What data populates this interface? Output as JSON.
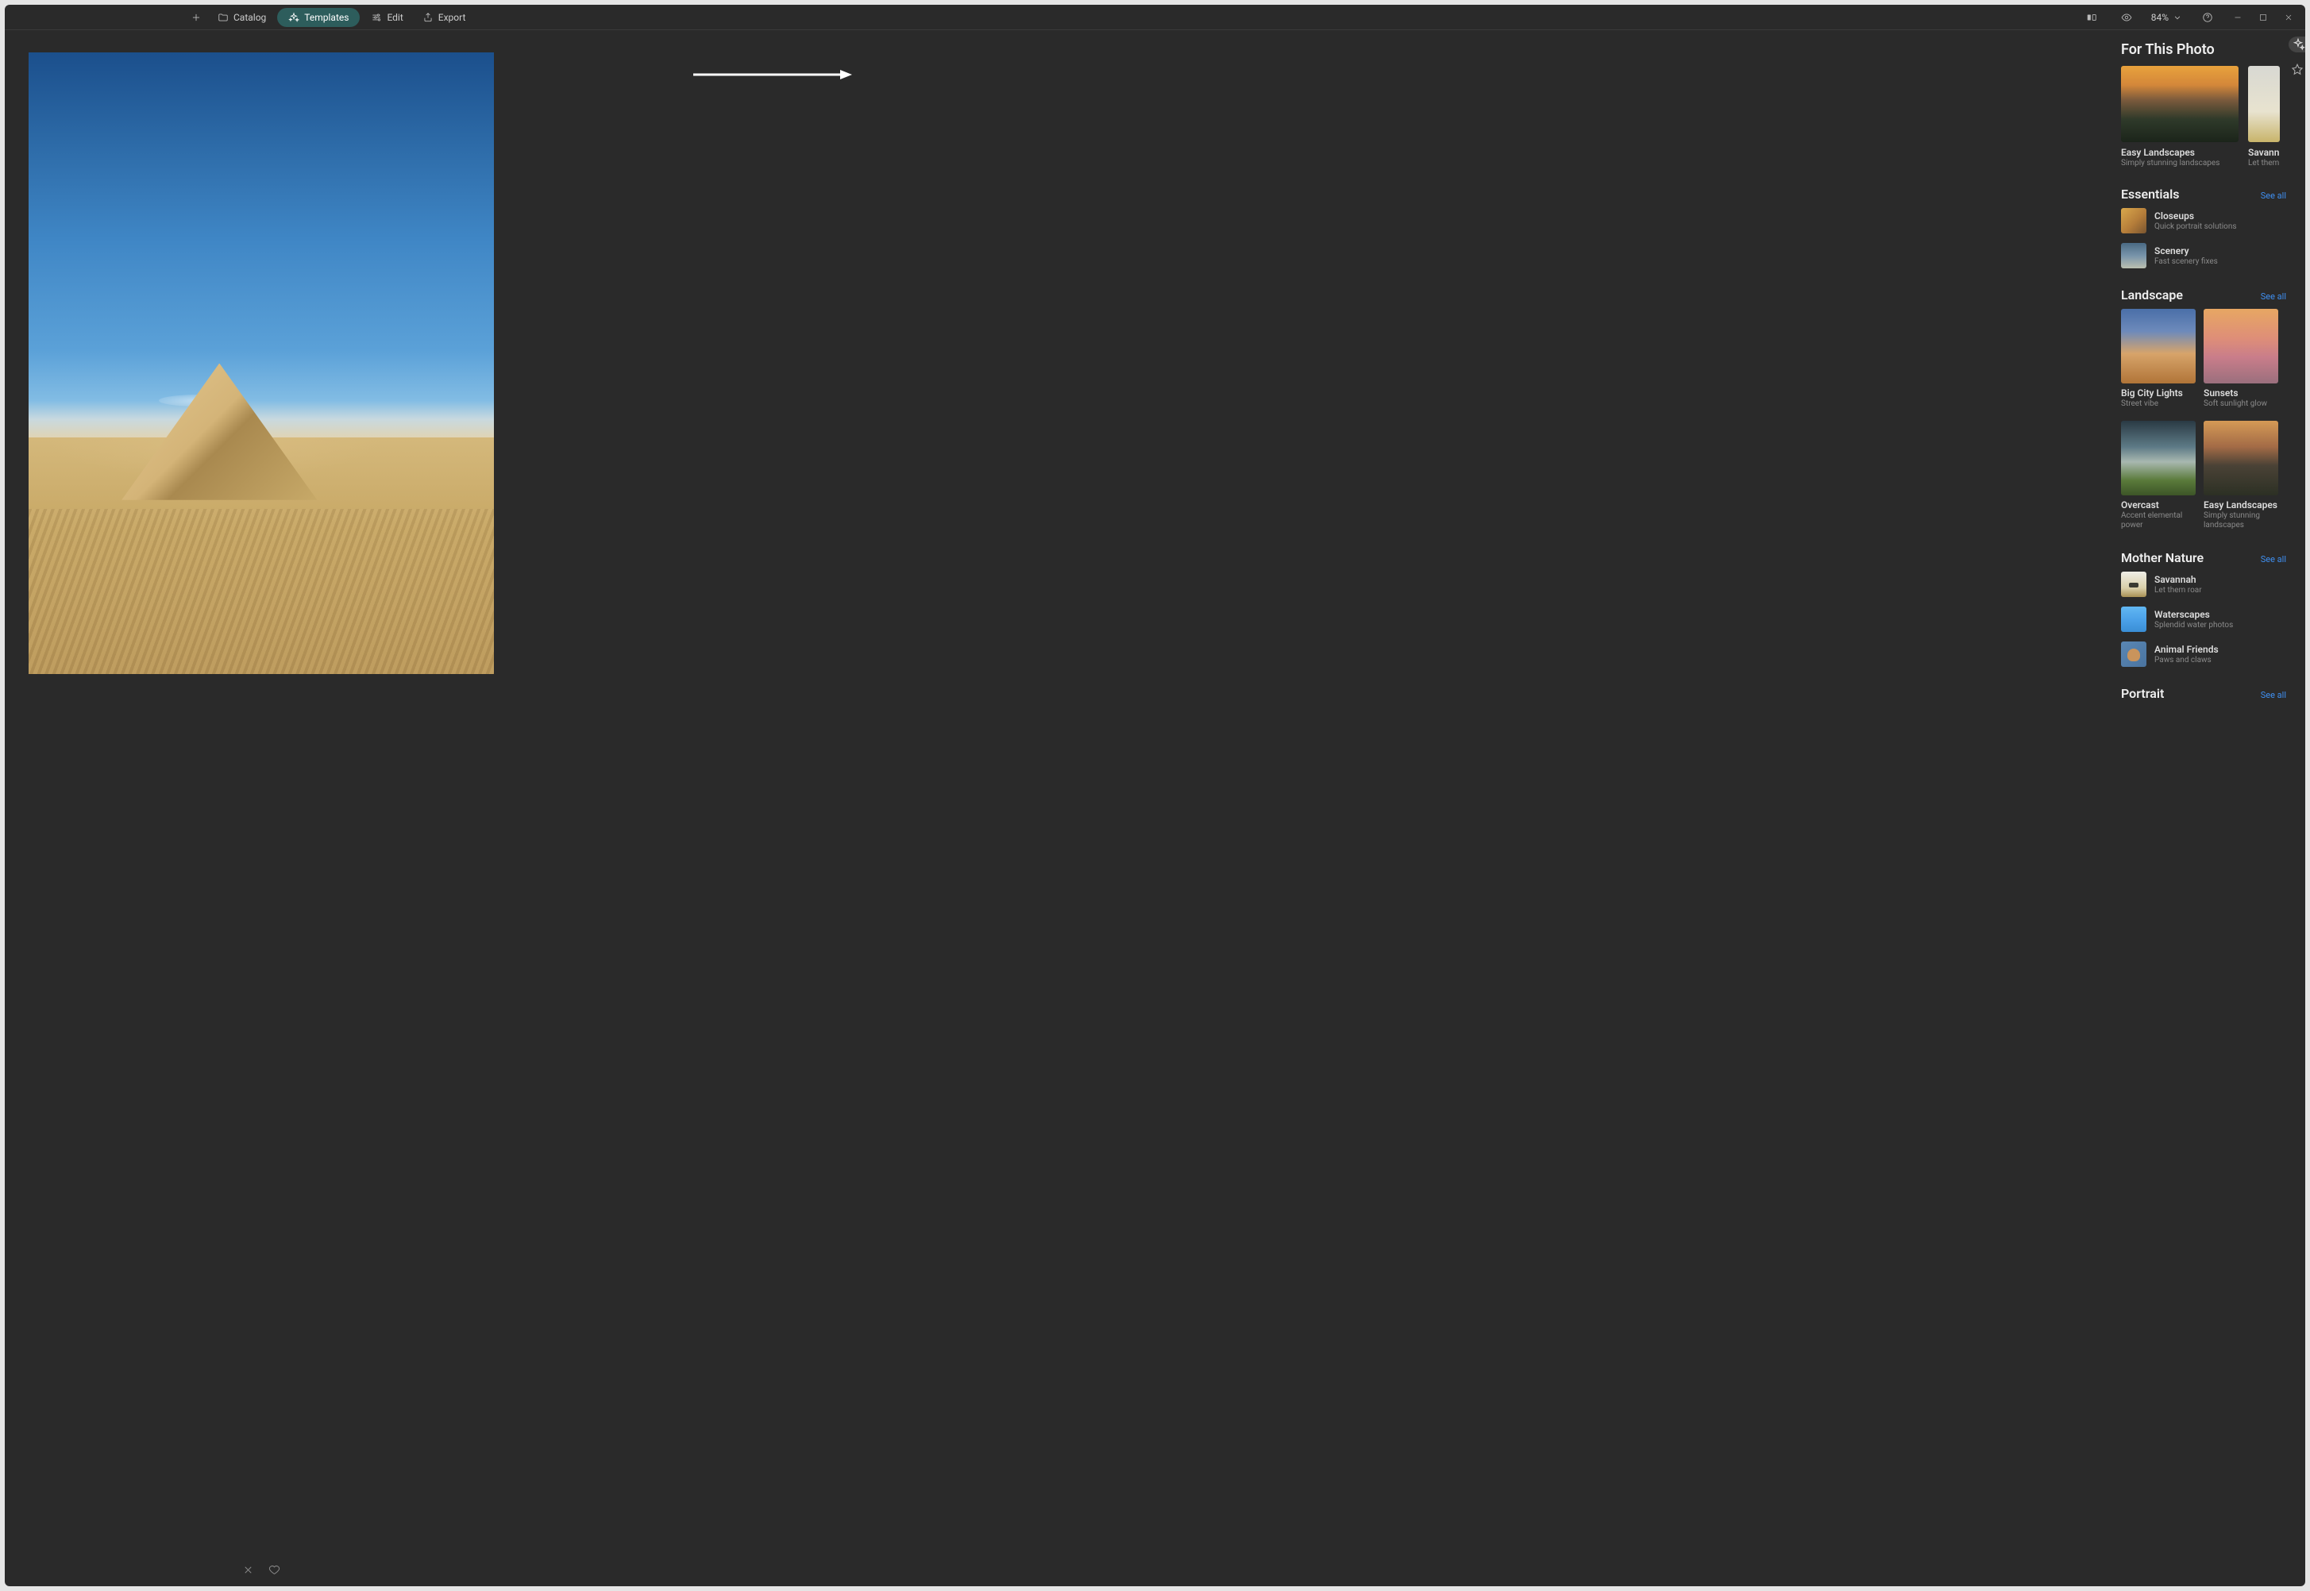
{
  "topbar": {
    "catalog": "Catalog",
    "templates": "Templates",
    "edit": "Edit",
    "export": "Export",
    "zoom": "84%"
  },
  "panel": {
    "for_this_photo": {
      "title": "For This Photo",
      "cards": [
        {
          "title": "Easy Landscapes",
          "desc": "Simply stunning landscapes"
        },
        {
          "title": "Savannah",
          "desc": "Let them roar"
        }
      ]
    },
    "essentials": {
      "title": "Essentials",
      "see_all": "See all",
      "items": [
        {
          "title": "Closeups",
          "desc": "Quick portrait solutions"
        },
        {
          "title": "Scenery",
          "desc": "Fast scenery fixes"
        }
      ]
    },
    "landscape": {
      "title": "Landscape",
      "see_all": "See all",
      "cards": [
        {
          "title": "Big City Lights",
          "desc": "Street vibe"
        },
        {
          "title": "Sunsets",
          "desc": "Soft sunlight glow"
        },
        {
          "title": "Overcast",
          "desc": "Accent elemental power"
        },
        {
          "title": "Easy Landscapes",
          "desc": "Simply stunning landscapes"
        }
      ]
    },
    "mother_nature": {
      "title": "Mother Nature",
      "see_all": "See all",
      "items": [
        {
          "title": "Savannah",
          "desc": "Let them roar"
        },
        {
          "title": "Waterscapes",
          "desc": "Splendid water photos"
        },
        {
          "title": "Animal Friends",
          "desc": "Paws and claws"
        }
      ]
    },
    "portrait": {
      "title": "Portrait",
      "see_all": "See all"
    }
  }
}
